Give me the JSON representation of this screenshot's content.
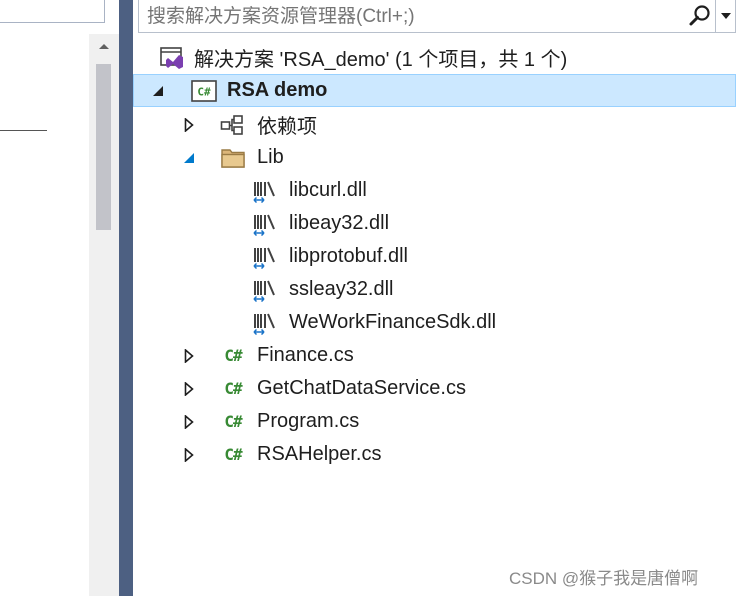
{
  "search": {
    "placeholder": "搜索解决方案资源管理器(Ctrl+;)"
  },
  "tree": {
    "solution": {
      "label": "解决方案 'RSA_demo' (1 个项目，共 1 个)"
    },
    "project": {
      "label": "RSA demo",
      "icon_text": "C#"
    },
    "dependencies": {
      "label": "依赖项"
    },
    "lib_folder": {
      "label": "Lib"
    },
    "dlls": [
      {
        "label": "libcurl.dll"
      },
      {
        "label": "libeay32.dll"
      },
      {
        "label": "libprotobuf.dll"
      },
      {
        "label": "ssleay32.dll"
      },
      {
        "label": "WeWorkFinanceSdk.dll"
      }
    ],
    "files": [
      {
        "label": "Finance.cs",
        "icon_text": "C#"
      },
      {
        "label": "GetChatDataService.cs",
        "icon_text": "C#"
      },
      {
        "label": "Program.cs",
        "icon_text": "C#"
      },
      {
        "label": "RSAHelper.cs",
        "icon_text": "C#"
      }
    ]
  },
  "watermark": "CSDN @猴子我是唐僧啊",
  "colors": {
    "divider": "#4d6082",
    "selection": "#cce8ff",
    "csharp_green": "#388a34",
    "folder": "#dcb67a"
  }
}
